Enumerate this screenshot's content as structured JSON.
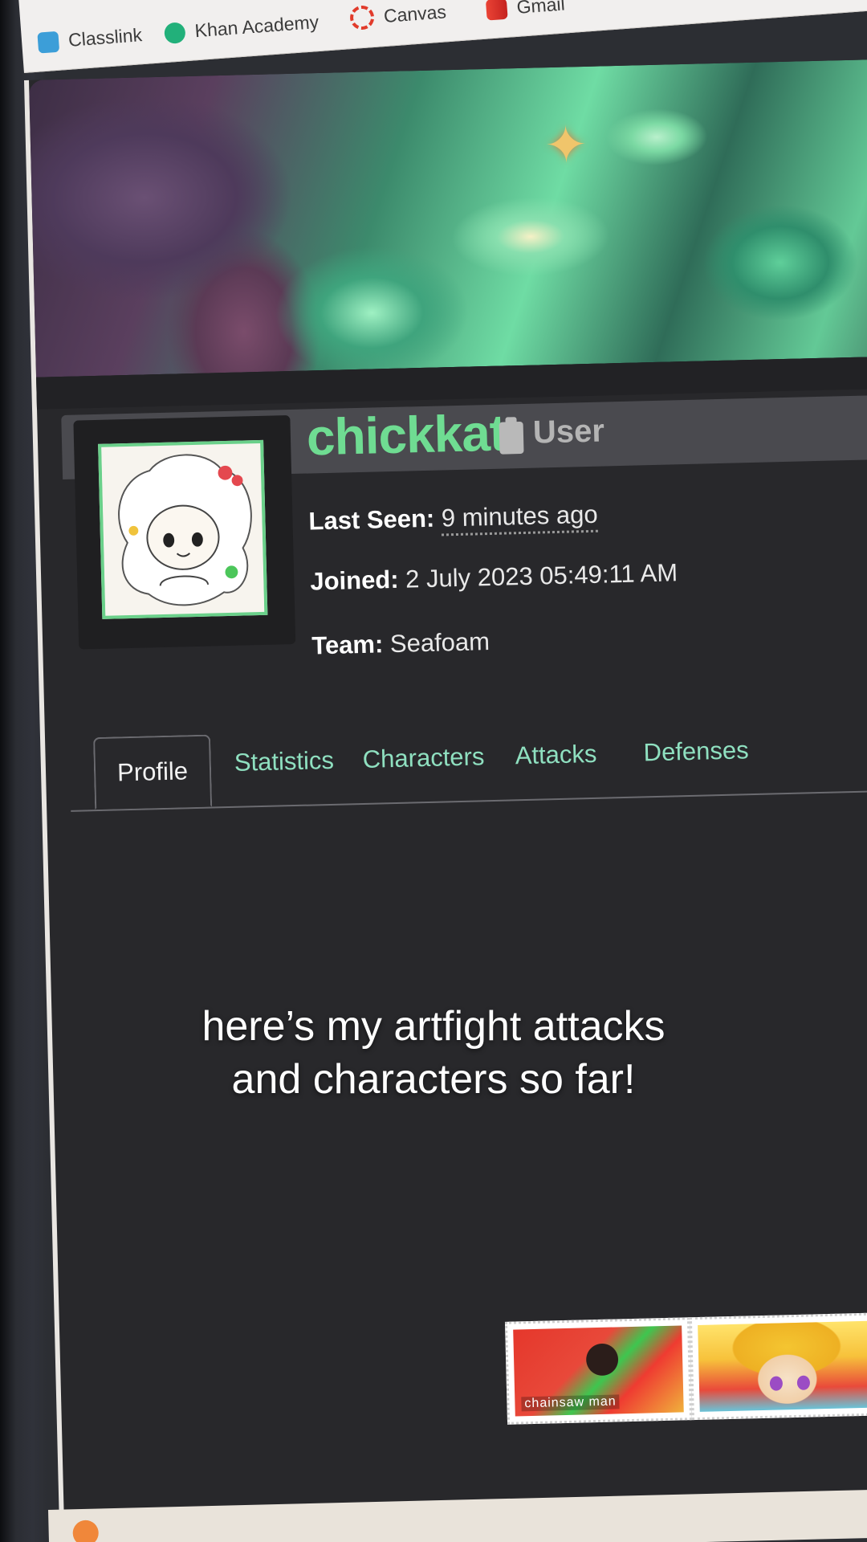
{
  "bookmarks": [
    {
      "label": "Classlink",
      "icon": "classlink-icon"
    },
    {
      "label": "Khan Academy",
      "icon": "khan-academy-icon"
    },
    {
      "label": "Canvas",
      "icon": "canvas-icon"
    },
    {
      "label": "Gmail",
      "icon": "gmail-icon"
    }
  ],
  "profile": {
    "username": "chickkat",
    "role": "User",
    "last_seen_label": "Last Seen:",
    "last_seen_value": "9 minutes ago",
    "joined_label": "Joined:",
    "joined_value": "2 July 2023 05:49:11 AM",
    "team_label": "Team:",
    "team_value": "Seafoam"
  },
  "tabs": [
    {
      "label": "Profile",
      "active": true
    },
    {
      "label": "Statistics",
      "active": false
    },
    {
      "label": "Characters",
      "active": false
    },
    {
      "label": "Attacks",
      "active": false
    },
    {
      "label": "Defenses",
      "active": false
    }
  ],
  "stamps": [
    {
      "caption": "chainsaw man"
    }
  ],
  "caption": {
    "line1": "here’s my artfight attacks",
    "line2": "and characters so far!"
  },
  "colors": {
    "username": "#6fdc92",
    "tab_link": "#8fe0c0",
    "page_bg": "#28282b"
  }
}
